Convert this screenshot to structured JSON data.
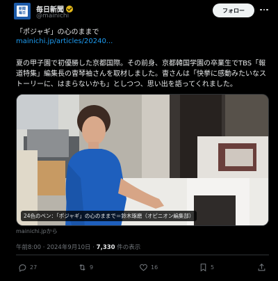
{
  "account": {
    "name": "毎日新聞",
    "handle": "@mainichi",
    "avatar_lines": [
      "新聞",
      "毎日"
    ],
    "verified_color": "#e2b719"
  },
  "follow_label": "フォロー",
  "post": {
    "headline": "「ポジャギ」の心のままで",
    "link": "mainichi.jp/articles/20240...",
    "body": "夏の甲子園で初優勝した京都国際。その前身、京都韓国学園の卒業生でTBS「報道特集」編集長の曺琴袖さんを取材しました。曺さんは「快挙に感動みたいなストーリーに、はまらないかも」としつつ、思い出を語ってくれました。"
  },
  "media": {
    "caption": "24色のペン：「ポジャギ」の心のままで＝鈴木琢磨（オピニオン編集部）",
    "source": "mainichi.jpから"
  },
  "meta": {
    "time": "午前8:00",
    "date": "2024年9月10日",
    "views": "7,330",
    "views_label": "件の表示",
    "separator": " · "
  },
  "actions": {
    "reply_count": "27",
    "repost_count": "9",
    "like_count": "16",
    "bookmark_count": "5"
  }
}
